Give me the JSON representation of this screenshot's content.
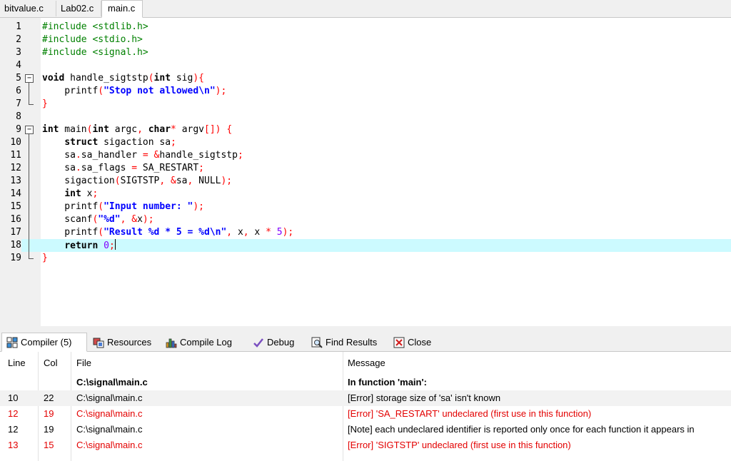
{
  "file_tabs": [
    "bitvalue.c",
    "Lab02.c",
    "main.c"
  ],
  "active_file_tab": "main.c",
  "editor": {
    "line_numbers": [
      "1",
      "2",
      "3",
      "4",
      "5",
      "6",
      "7",
      "8",
      "9",
      "10",
      "11",
      "12",
      "13",
      "14",
      "15",
      "16",
      "17",
      "18",
      "19"
    ],
    "current_line": "18",
    "code_lines": [
      "#include <stdlib.h>",
      "#include <stdio.h>",
      "#include <signal.h>",
      "",
      "void handle_sigtstp(int sig){",
      "    printf(\"Stop not allowed\\n\");",
      "}",
      "",
      "int main(int argc, char* argv[]) {",
      "    struct sigaction sa;",
      "    sa.sa_handler = &handle_sigtstp;",
      "    sa.sa_flags = SA_RESTART;",
      "    sigaction(SIGTSTP, &sa, NULL);",
      "    int x;",
      "    printf(\"Input number: \");",
      "    scanf(\"%d\", &x);",
      "    printf(\"Result %d * 5 = %d\\n\", x, x * 5);",
      "    return 0;",
      "}"
    ]
  },
  "bottom_tabs": [
    {
      "label": "Compiler (5)",
      "icon": "compiler-grid-icon"
    },
    {
      "label": "Resources",
      "icon": "resources-icon"
    },
    {
      "label": "Compile Log",
      "icon": "bar-chart-icon"
    },
    {
      "label": "Debug",
      "icon": "checkmark-icon"
    },
    {
      "label": "Find Results",
      "icon": "find-results-icon"
    },
    {
      "label": "Close",
      "icon": "close-icon"
    }
  ],
  "results": {
    "columns": [
      "Line",
      "Col",
      "File",
      "Message"
    ],
    "rows": [
      {
        "line": "",
        "col": "",
        "file": "C:\\signal\\main.c",
        "message": "In function 'main':",
        "kind": "header"
      },
      {
        "line": "10",
        "col": "22",
        "file": "C:\\signal\\main.c",
        "message": "[Error] storage size of 'sa' isn't known",
        "kind": "normal"
      },
      {
        "line": "12",
        "col": "19",
        "file": "C:\\signal\\main.c",
        "message": "[Error] 'SA_RESTART' undeclared (first use in this function)",
        "kind": "error"
      },
      {
        "line": "12",
        "col": "19",
        "file": "C:\\signal\\main.c",
        "message": "[Note] each undeclared identifier is reported only once for each function it appears in",
        "kind": "normal"
      },
      {
        "line": "13",
        "col": "15",
        "file": "C:\\signal\\main.c",
        "message": "[Error] 'SIGTSTP' undeclared (first use in this function)",
        "kind": "error"
      }
    ]
  },
  "colors": {
    "current_line_highlight": "#ccfaff",
    "error_text": "#e30000",
    "preprocessor": "#008000",
    "string": "#0000ff",
    "symbol": "#ff0000",
    "number": "#8000ff"
  }
}
